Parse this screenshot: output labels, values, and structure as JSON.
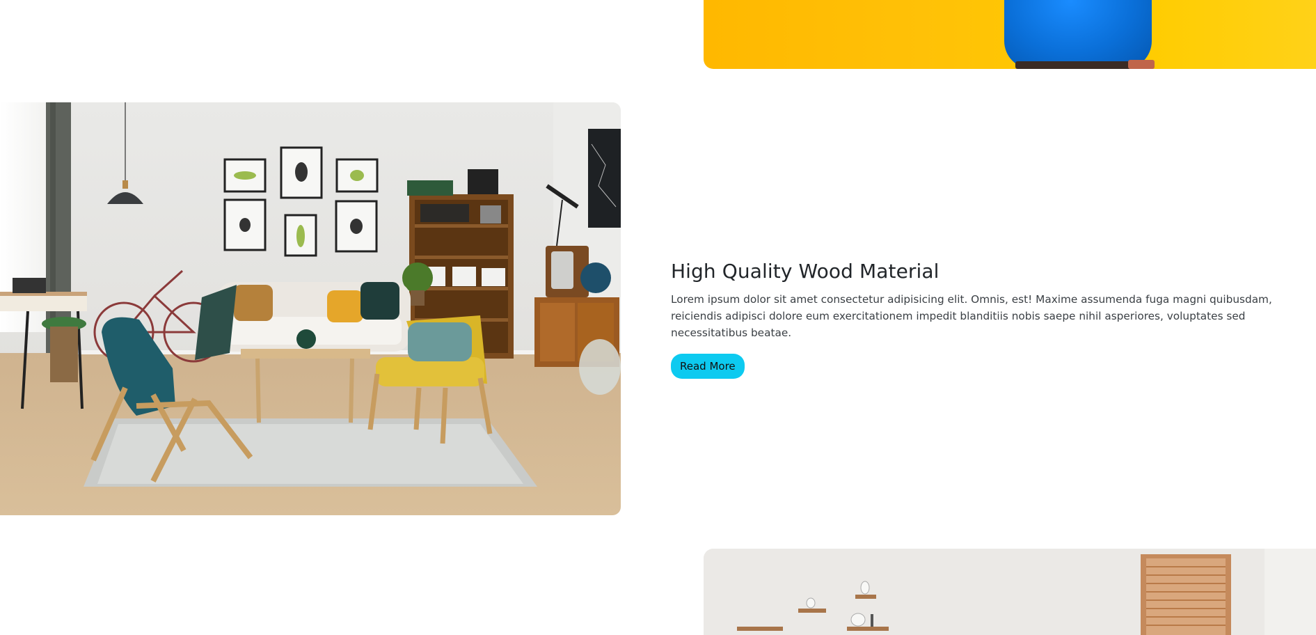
{
  "feature": {
    "title": "High Quality Wood Material",
    "description": "Lorem ipsum dolor sit amet consectetur adipisicing elit. Omnis, est! Maxime assumenda fuga magni quibusdam, reiciendis adipisci dolore eum exercitationem impedit blanditiis nobis saepe nihil asperiores, voluptates sed necessitatibus beatae.",
    "button_label": "Read More"
  },
  "images": {
    "top": "yellow-background-person-blue-shirt",
    "main": "living-room-interior",
    "bottom": "white-room-shelves-window"
  },
  "colors": {
    "accent": "#0dcaf0",
    "title": "#212529",
    "yellow": "#ffc107"
  }
}
